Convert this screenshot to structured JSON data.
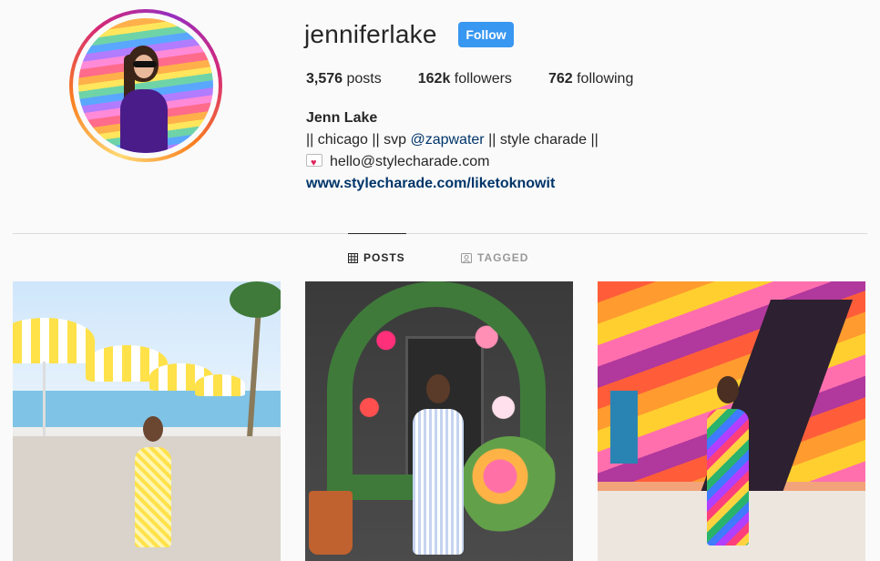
{
  "profile": {
    "username": "jenniferlake",
    "follow_label": "Follow",
    "stats": {
      "posts_count": "3,576",
      "posts_label": "posts",
      "followers_count": "162k",
      "followers_label": "followers",
      "following_count": "762",
      "following_label": "following"
    },
    "bio": {
      "name": "Jenn Lake",
      "line1_prefix": "|| chicago || svp ",
      "line1_mention": "@zapwater",
      "line1_suffix": " || style charade ||",
      "email": "hello@stylecharade.com",
      "website": "www.stylecharade.com/liketoknowit"
    }
  },
  "tabs": [
    {
      "label": "POSTS",
      "active": true,
      "icon": "grid-icon"
    },
    {
      "label": "TAGGED",
      "active": false,
      "icon": "tag-portrait-icon"
    }
  ],
  "colors": {
    "follow_button": "#3897f0",
    "link": "#003569",
    "background": "#fafafa"
  }
}
